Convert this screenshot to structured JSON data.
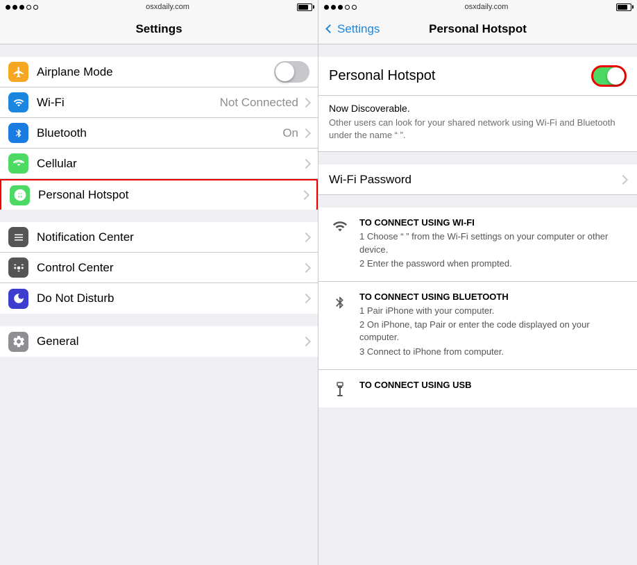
{
  "left": {
    "statusBar": {
      "url": "osxdaily.com",
      "dots": [
        "filled",
        "filled",
        "filled",
        "empty",
        "empty"
      ]
    },
    "navTitle": "Settings",
    "rows": [
      {
        "id": "airplane",
        "label": "Airplane Mode",
        "iconColor": "orange",
        "iconType": "airplane",
        "control": "toggle",
        "value": ""
      },
      {
        "id": "wifi",
        "label": "Wi-Fi",
        "iconColor": "blue",
        "iconType": "wifi",
        "control": "chevron",
        "value": "Not Connected"
      },
      {
        "id": "bluetooth",
        "label": "Bluetooth",
        "iconColor": "blue-dark",
        "iconType": "bluetooth",
        "control": "chevron",
        "value": "On"
      },
      {
        "id": "cellular",
        "label": "Cellular",
        "iconColor": "green-dark",
        "iconType": "cellular",
        "control": "chevron",
        "value": ""
      },
      {
        "id": "hotspot",
        "label": "Personal Hotspot",
        "iconColor": "green",
        "iconType": "hotspot",
        "control": "chevron",
        "value": "",
        "highlight": true
      },
      {
        "id": "notification",
        "label": "Notification Center",
        "iconColor": "dark-gray",
        "iconType": "notification",
        "control": "chevron",
        "value": ""
      },
      {
        "id": "control",
        "label": "Control Center",
        "iconColor": "dark-gray2",
        "iconType": "control",
        "control": "chevron",
        "value": ""
      },
      {
        "id": "dnd",
        "label": "Do Not Disturb",
        "iconColor": "indigo-dark",
        "iconType": "moon",
        "control": "chevron",
        "value": ""
      },
      {
        "id": "general",
        "label": "General",
        "iconColor": "gear-gray",
        "iconType": "gear",
        "control": "chevron",
        "value": ""
      }
    ]
  },
  "right": {
    "statusBar": {
      "url": "osxdaily.com",
      "dots": [
        "filled",
        "filled",
        "filled",
        "empty",
        "empty"
      ]
    },
    "backLabel": "Settings",
    "navTitle": "Personal Hotspot",
    "hotspot": {
      "label": "Personal Hotspot",
      "enabled": true
    },
    "discoverable": {
      "title": "Now Discoverable.",
      "desc": "Other users can look for your shared network using Wi-Fi and Bluetooth under the name “                ”."
    },
    "wifiPassword": {
      "label": "Wi-Fi Password"
    },
    "connectSections": [
      {
        "iconType": "wifi",
        "title": "TO CONNECT USING WI-FI",
        "steps": [
          "1 Choose “                ” from the Wi-Fi settings on your computer or other device.",
          "2 Enter the password when prompted."
        ]
      },
      {
        "iconType": "bluetooth",
        "title": "TO CONNECT USING BLUETOOTH",
        "steps": [
          "1 Pair iPhone with your computer.",
          "2 On iPhone, tap Pair or enter the code displayed on your computer.",
          "3 Connect to iPhone from computer."
        ]
      },
      {
        "iconType": "usb",
        "title": "TO CONNECT USING USB",
        "steps": []
      }
    ]
  }
}
